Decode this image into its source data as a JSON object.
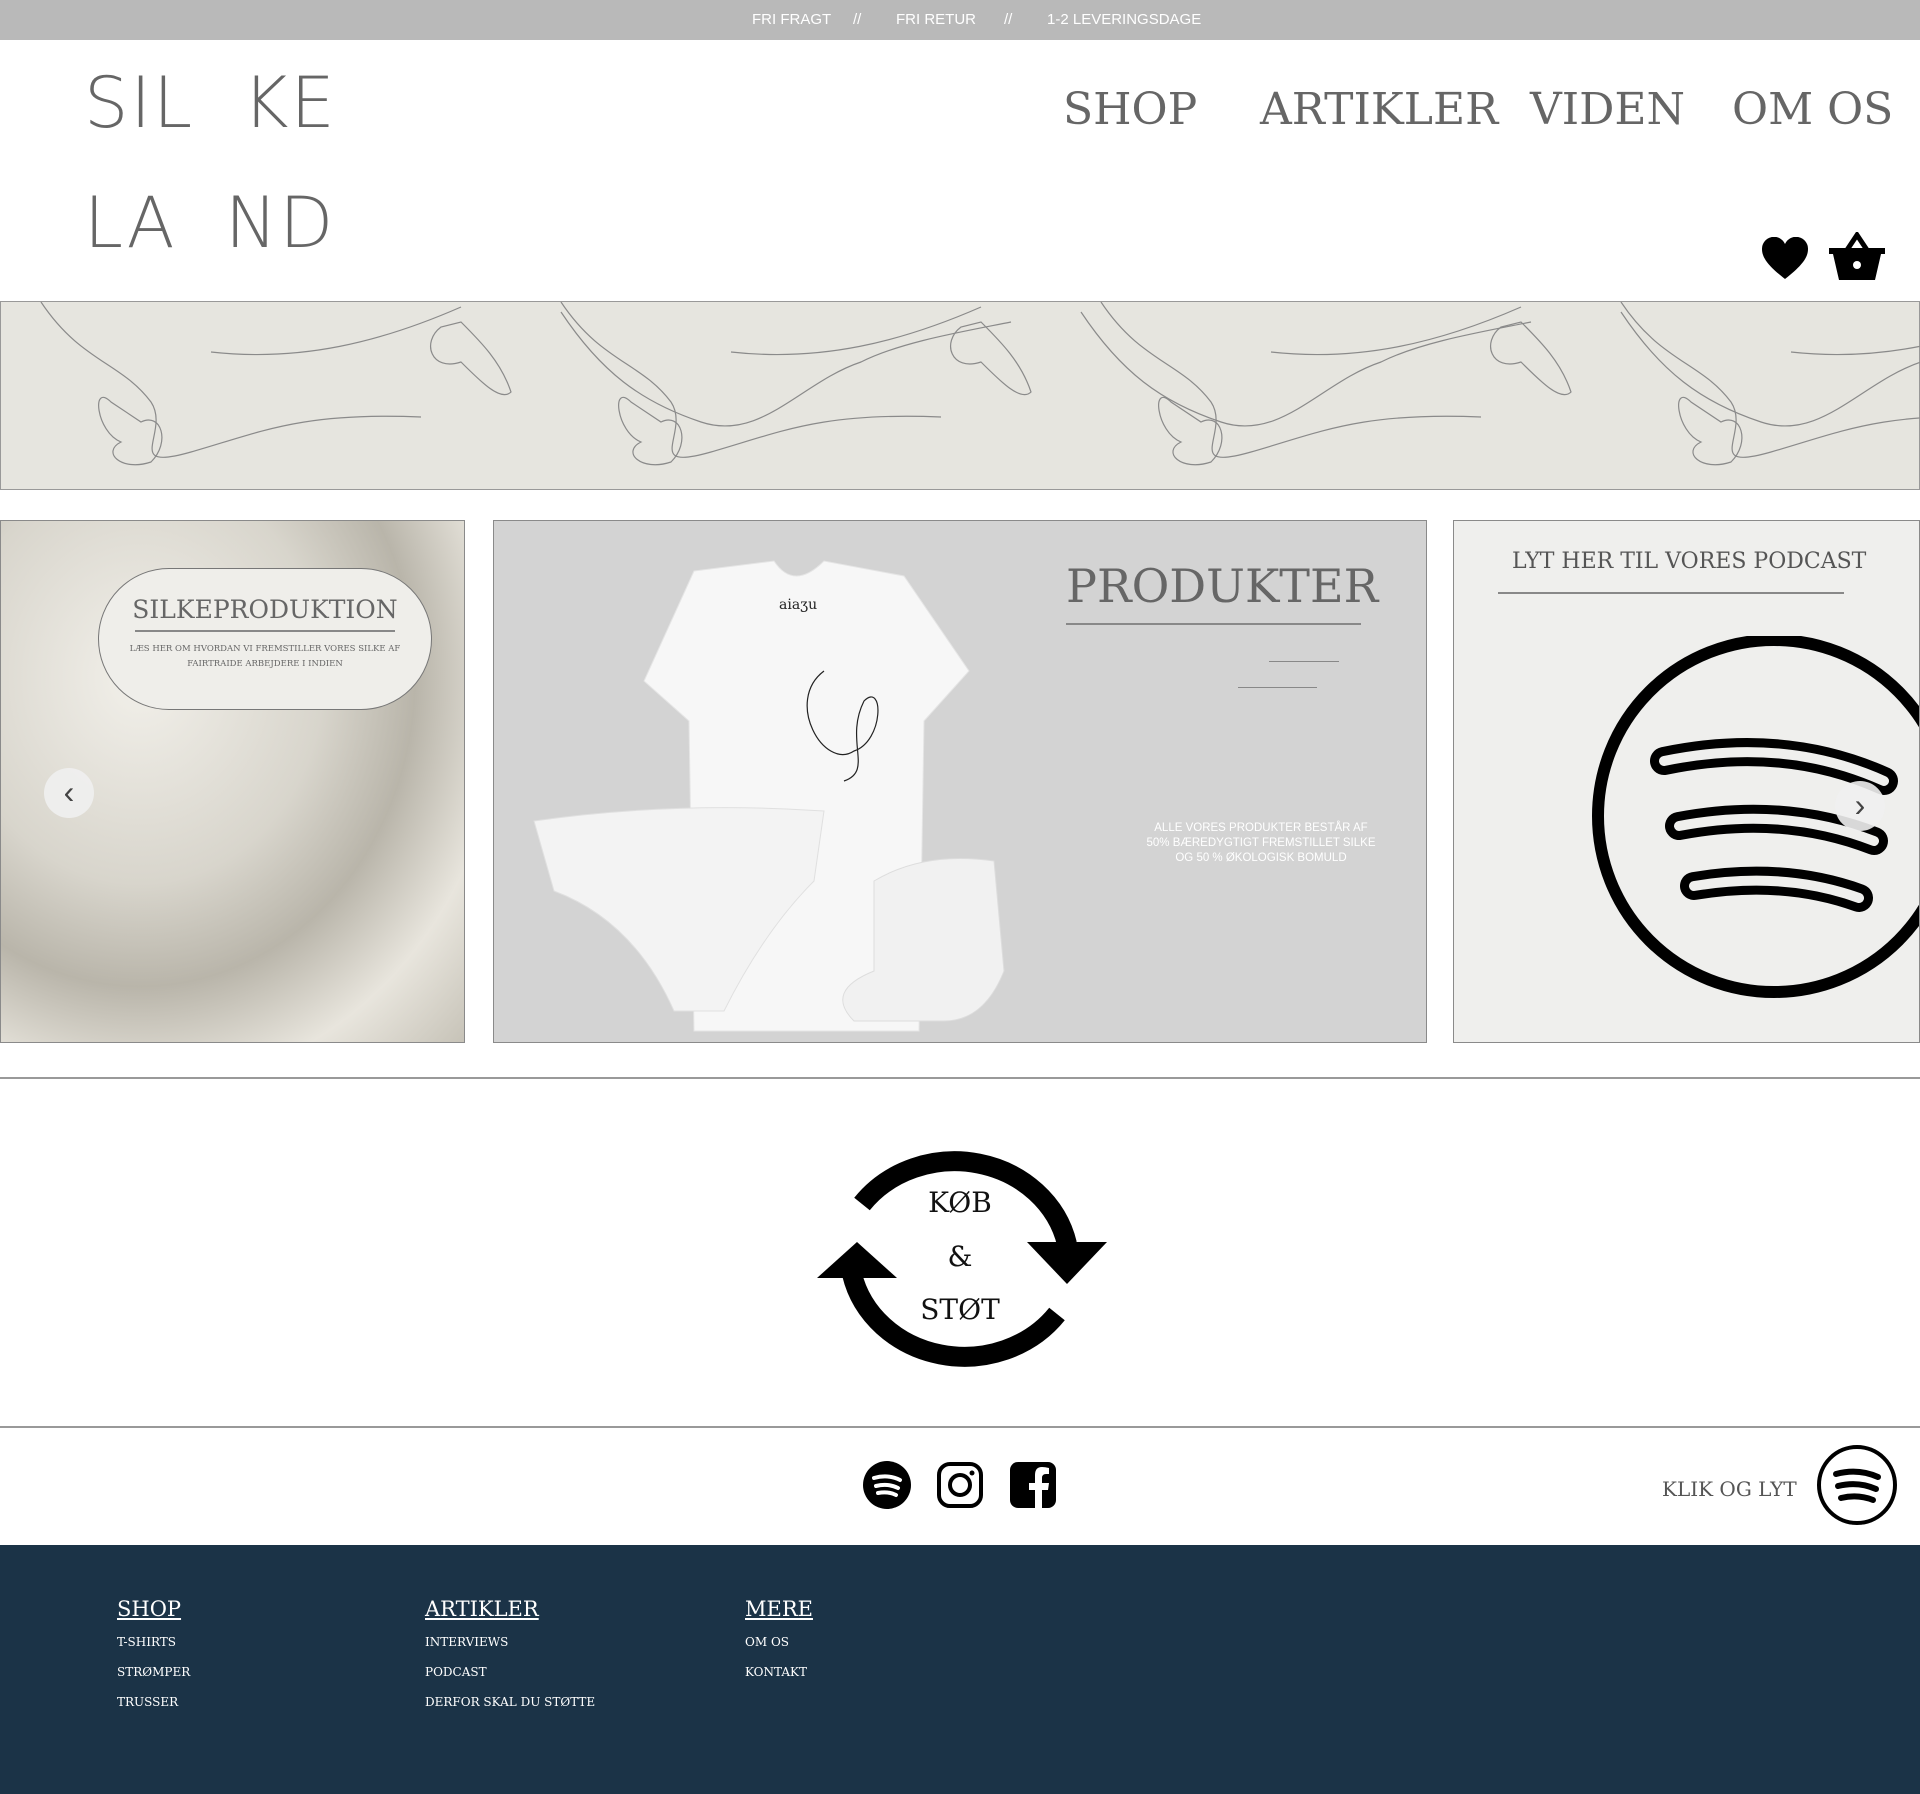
{
  "topbar": {
    "items": [
      "FRI FRAGT",
      "//",
      "FRI RETUR",
      "//",
      "1-2 LEVERINGSDAGE"
    ]
  },
  "logo": {
    "line1": "SIL  KE",
    "line2": "LA  ND"
  },
  "nav": {
    "items": [
      "SHOP",
      "ARTIKLER",
      "VIDEN",
      "OM OS"
    ]
  },
  "header_icons": [
    "heart-icon",
    "basket-icon"
  ],
  "slides": {
    "silk": {
      "title": "SILKEPRODUKTION",
      "text": "LÆS HER OM HVORDAN VI FREMSTILLER VORES SILKE AF FAIRTRAIDE ARBEJDERE I INDIEN"
    },
    "products": {
      "title": "PRODUKTER",
      "text": "ALLE VORES PRODUKTER BESTÅR AF 50% BÆREDYGTIGT FREMSTILLET SILKE OG 50 % ØKOLOGISK BOMULD",
      "shirt_label": "aiaʒu"
    },
    "podcast": {
      "title": "LYT HER TIL VORES PODCAST"
    },
    "prev": "‹",
    "next": "›"
  },
  "cycle": {
    "line1": "KØB",
    "line2": "&",
    "line3": "STØT"
  },
  "social": {
    "icons": [
      "spotify-icon",
      "instagram-icon",
      "facebook-icon"
    ],
    "listen_label": "KLIK OG LYT"
  },
  "footer": {
    "columns": [
      {
        "title": "SHOP",
        "items": [
          "T-SHIRTS",
          "STRØMPER",
          "TRUSSER"
        ]
      },
      {
        "title": "ARTIKLER",
        "items": [
          "INTERVIEWS",
          "PODCAST",
          "DERFOR SKAL DU STØTTE"
        ]
      },
      {
        "title": "MERE",
        "items": [
          "OM OS",
          "KONTAKT"
        ]
      }
    ]
  },
  "colors": {
    "footer": "#1b3347",
    "topbar": "#b9b9b9",
    "banner": "#e6e5df"
  }
}
